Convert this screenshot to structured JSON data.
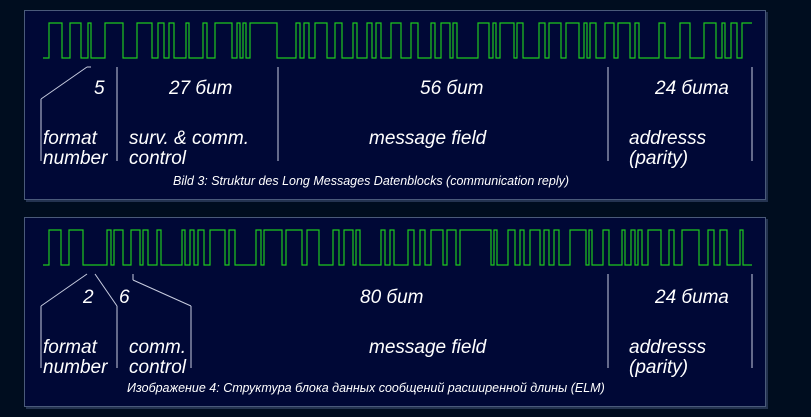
{
  "figure1": {
    "format_count": "5",
    "surv_bits": "27 бит",
    "message_bits": "56 бит",
    "address_bits": "24 бита",
    "format_label_1": "format",
    "format_label_2": "number",
    "surv_label_1": "surv. & comm.",
    "surv_label_2": "control",
    "message_label": "message field",
    "address_label_1": "addresss",
    "address_label_2": "(parity)",
    "caption": "Bild 3: Struktur des Long Messages Datenblocks (communication reply)"
  },
  "figure2": {
    "format_count": "2",
    "comm_count": "6",
    "message_bits": "80 бит",
    "address_bits": "24 бита",
    "format_label_1": "format",
    "format_label_2": "number",
    "comm_label_1": "comm.",
    "comm_label_2": "control",
    "message_label": "message field",
    "address_label_1": "addresss",
    "address_label_2": "(parity)",
    "caption": "Изображение 4: Структура блока данных сообщений расширенной длины (ELM)"
  },
  "colors": {
    "signal": "#1ec81e",
    "background": "#000836",
    "text": "#ffffff"
  }
}
